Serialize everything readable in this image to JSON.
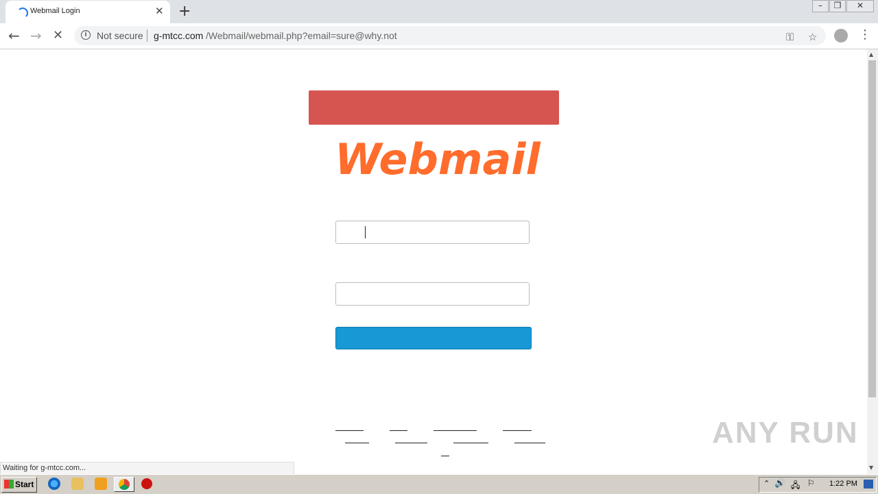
{
  "browser": {
    "tab_title": "Webmail Login",
    "tab_close": "✕",
    "new_tab": "+",
    "security_label": "Not secure",
    "url_domain": "g-mtcc.com",
    "url_path": "/Webmail/webmail.php?email=sure@why.not",
    "status_text": "Waiting for g-mtcc.com..."
  },
  "page": {
    "logo_text": "Webmail",
    "banner_color": "#d65550",
    "logo_color": "#ff6c2c",
    "button_color": "#1898d5",
    "watermark": "ANY RUN"
  },
  "taskbar": {
    "start_label": "Start",
    "clock": "1:22 PM"
  }
}
